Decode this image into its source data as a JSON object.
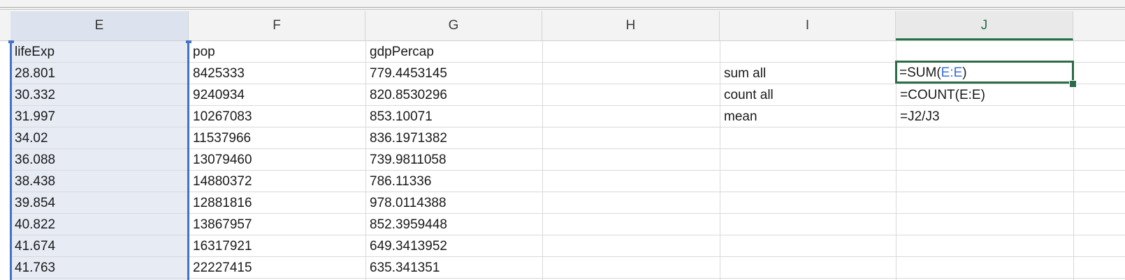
{
  "columns": [
    "E",
    "F",
    "G",
    "H",
    "I",
    "J"
  ],
  "grid": {
    "rows": [
      [
        "lifeExp",
        "pop",
        "gdpPercap",
        "",
        "",
        ""
      ],
      [
        "28.801",
        "8425333",
        "779.4453145",
        "",
        "sum all",
        ""
      ],
      [
        "30.332",
        "9240934",
        "820.8530296",
        "",
        "count all",
        "=COUNT(E:E)"
      ],
      [
        "31.997",
        "10267083",
        "853.10071",
        "",
        "mean",
        "=J2/J3"
      ],
      [
        "34.02",
        "11537966",
        "836.1971382",
        "",
        "",
        ""
      ],
      [
        "36.088",
        "13079460",
        "739.9811058",
        "",
        "",
        ""
      ],
      [
        "38.438",
        "14880372",
        "786.11336",
        "",
        "",
        ""
      ],
      [
        "39.854",
        "12881816",
        "978.0114388",
        "",
        "",
        ""
      ],
      [
        "40.822",
        "13867957",
        "852.3959448",
        "",
        "",
        ""
      ],
      [
        "41.674",
        "16317921",
        "649.3413952",
        "",
        "",
        ""
      ],
      [
        "41.763",
        "22227415",
        "635.341351",
        "",
        "",
        ""
      ]
    ]
  },
  "editing_formula": {
    "prefix": "=SUM(",
    "range_ref": "E:E",
    "suffix": ")"
  },
  "colors": {
    "selection_fill": "#e6ebf4",
    "selection_border": "#4472c4",
    "active_cell_border": "#2e6b48",
    "active_column_header": "#217346",
    "formula_reference": "#3a6fd8"
  }
}
